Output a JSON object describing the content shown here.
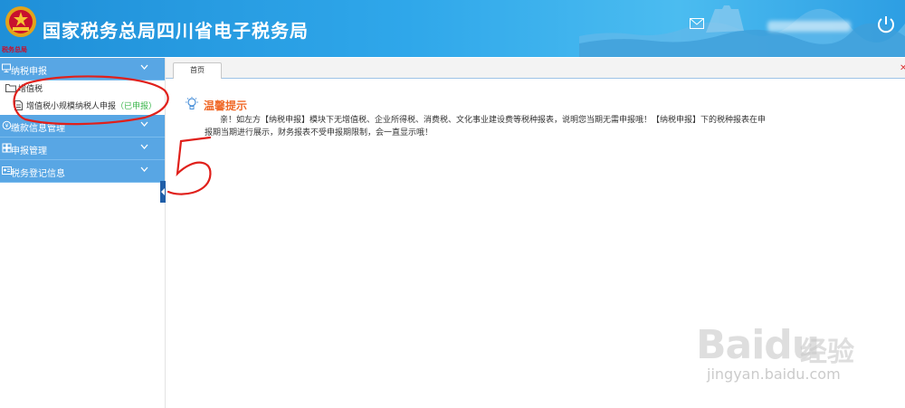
{
  "header": {
    "emblem_caption": "税务总局",
    "title": "国家税务总局四川省电子税务局"
  },
  "sidebar": {
    "groups": [
      {
        "label": "纳税申报"
      },
      {
        "label": "缴款信息管理"
      },
      {
        "label": "申报管理"
      },
      {
        "label": "税务登记信息"
      }
    ],
    "folder_label": "增值税",
    "leaf_label": "增值税小规模纳税人申报",
    "leaf_status": "（已申报）"
  },
  "tabs": [
    {
      "label": "首页"
    }
  ],
  "content": {
    "tip_title": "温馨提示",
    "tip_text": "亲！如左方【纳税申报】模块下无增值税、企业所得税、消费税、文化事业建设费等税种报表，说明您当期无需申报哦！【纳税申报】下的税种报表在申报期当期进行展示，财务报表不受申报期限制，会一直显示哦！"
  },
  "watermark": {
    "brand": "Baidu",
    "brand_cn": "经验",
    "url": "jingyan.baidu.com"
  },
  "colors": {
    "header": "#2fa7ea",
    "sidebar_group": "#58a6e4",
    "tip_title": "#f06a2a",
    "status_green": "#39b54a",
    "annotation": "#e0201b"
  },
  "icons": [
    "mail-icon",
    "power-icon",
    "monitor-icon",
    "folder-icon",
    "document-icon",
    "lightbulb-icon",
    "chevron-down-icon"
  ]
}
